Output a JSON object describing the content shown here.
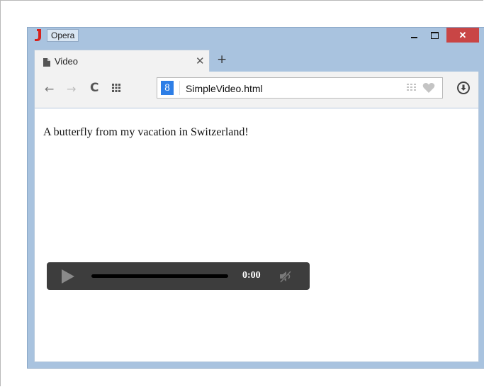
{
  "window": {
    "app_name": "Opera",
    "buttons": {
      "minimize": "minimize",
      "maximize": "maximize",
      "close": "✕"
    }
  },
  "tab": {
    "title": "Video",
    "close_glyph": "✕"
  },
  "new_tab_glyph": "+",
  "toolbar": {
    "back_glyph": "←",
    "forward_glyph": "→",
    "reload_glyph": "C"
  },
  "address_bar": {
    "search_engine_glyph": "8",
    "url": "SimpleVideo.html"
  },
  "page": {
    "caption": "A butterfly from my vacation in Switzerland!"
  },
  "video_player": {
    "time": "0:00",
    "playback_progress": 0
  },
  "colors": {
    "window_frame": "#a9c3df",
    "close_button": "#c94545",
    "search_engine": "#2d7ee6",
    "player_background": "#3d3d3d"
  },
  "icons": [
    "opera-logo-icon",
    "page-icon",
    "close-icon",
    "plus-icon",
    "back-arrow-icon",
    "forward-arrow-icon",
    "reload-icon",
    "speed-dial-grid-icon",
    "search-engine-icon",
    "grid-icon",
    "heart-icon",
    "download-icon",
    "play-icon",
    "mute-icon"
  ]
}
